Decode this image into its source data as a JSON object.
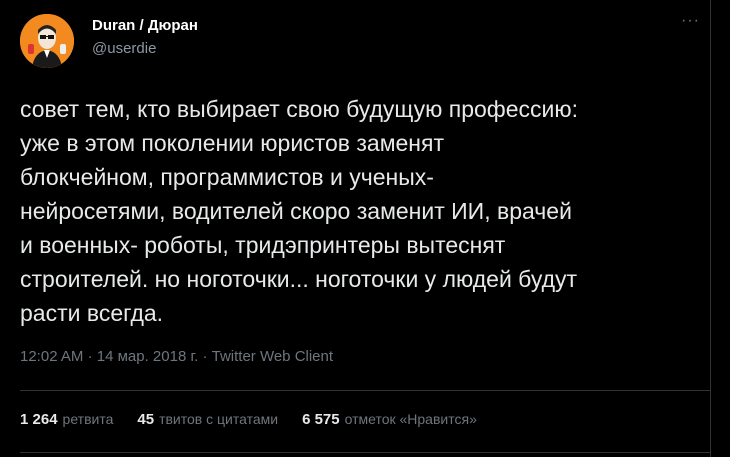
{
  "tweet": {
    "display_name": "Duran / Дюран",
    "handle": "@userdie",
    "text": "совет тем, кто выбирает свою будущую профессию:\nуже в этом поколении юристов заменят\nблокчейном, программистов и ученых-\nнейросетями, водителей скоро заменит ИИ, врачей\nи военных- роботы, тридэпринтеры вытеснят\nстроителей. но ноготочки... ноготочки у людей будут\nрасти всегда.",
    "time": "12:02 AM",
    "date": "14 мар. 2018 г.",
    "source": "Twitter Web Client",
    "sep": "·"
  },
  "stats": {
    "retweets_count": "1 264",
    "retweets_label": "ретвита",
    "quotes_count": "45",
    "quotes_label": "твитов с цитатами",
    "likes_count": "6 575",
    "likes_label": "отметок «Нравится»"
  },
  "icons": {
    "more": "more-horizontal-icon"
  },
  "colors": {
    "background": "#000000",
    "text": "#e7e9ea",
    "muted": "#6e767d",
    "avatar_bg": "#f28a1f"
  }
}
